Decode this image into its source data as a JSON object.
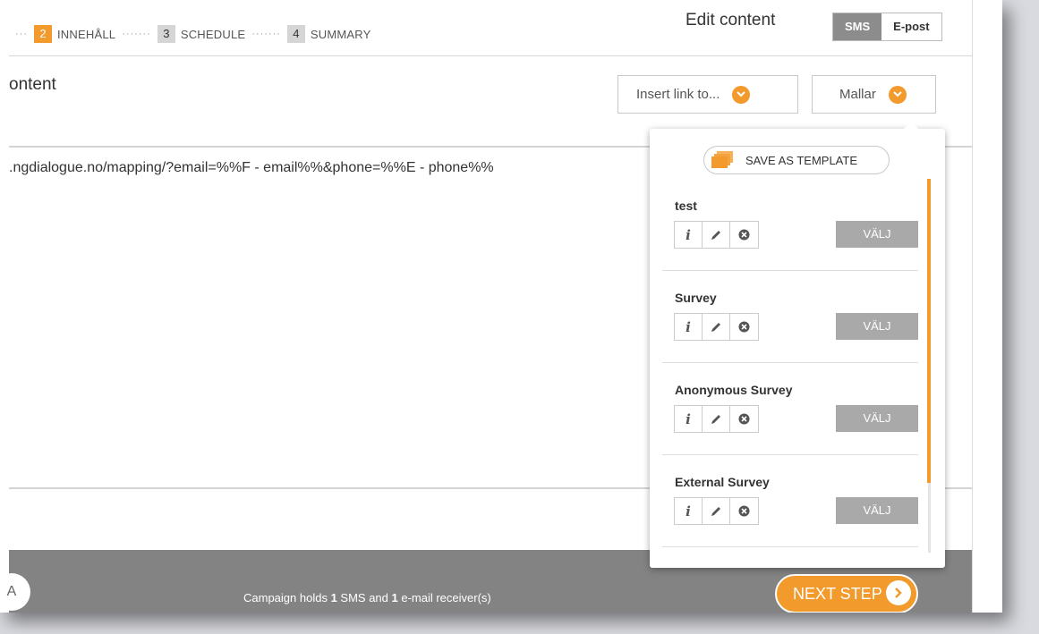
{
  "steps": [
    {
      "num": "2",
      "label": "INNEHÅLL",
      "active": true
    },
    {
      "num": "3",
      "label": "SCHEDULE",
      "active": false
    },
    {
      "num": "4",
      "label": "SUMMARY",
      "active": false
    }
  ],
  "step_separator": "·······",
  "step_leading": "···",
  "header": {
    "edit_title": "Edit content",
    "toggle": {
      "sms": "SMS",
      "email": "E-post"
    }
  },
  "content": {
    "title": "ontent",
    "insert_link_label": "Insert link to...",
    "templates_label": "Mallar",
    "editor_text": ".ngdialogue.no/mapping/?email=%%F - email%%&phone=%%E - phone%%"
  },
  "templates_panel": {
    "save_label": "SAVE AS TEMPLATE",
    "items": [
      {
        "name": "test",
        "select_label": "VÄLJ"
      },
      {
        "name": "Survey",
        "select_label": "VÄLJ"
      },
      {
        "name": "Anonymous Survey",
        "select_label": "VÄLJ"
      },
      {
        "name": "External Survey",
        "select_label": "VÄLJ"
      }
    ]
  },
  "footer": {
    "avatar": "A",
    "msg_prefix": "Campaign holds ",
    "sms_count": "1",
    "msg_mid": " SMS and ",
    "email_count": "1",
    "msg_suffix": " e-mail receiver(s)",
    "next_label": "NEXT STEP"
  },
  "colors": {
    "accent": "#f39a2c",
    "footer": "#838383",
    "button_grey": "#a9a9a9"
  }
}
